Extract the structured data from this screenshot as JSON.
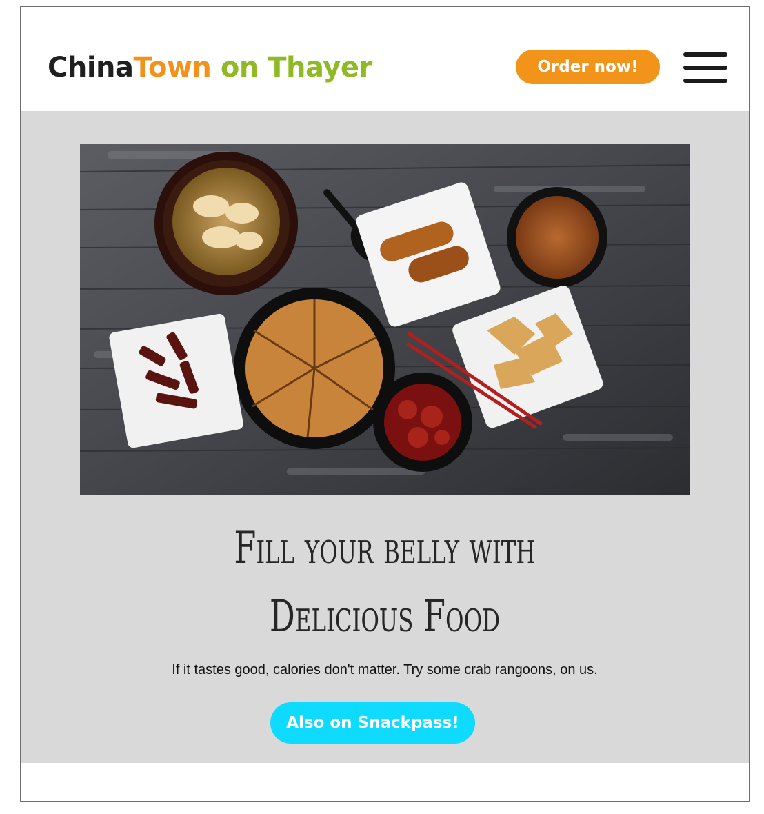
{
  "header": {
    "brand": {
      "part1": "China",
      "part2": "Town",
      "part3": " on Thayer"
    },
    "order_button": "Order now!",
    "menu_icon": "hamburger-menu-icon"
  },
  "hero": {
    "headline_line1": "Fill your belly with",
    "headline_line2": "Delicious Food",
    "tagline": "If it tastes good, calories don't matter. Try some crab rangoons, on us.",
    "snackpass_button": "Also on Snackpass!"
  },
  "colors": {
    "brand_dark": "#1f1f1f",
    "brand_orange": "#f0921b",
    "brand_green": "#8fba26",
    "order_button_bg": "#f2931a",
    "snackpass_button_bg": "#0fdaff",
    "hero_bg": "#d9d9d9"
  }
}
